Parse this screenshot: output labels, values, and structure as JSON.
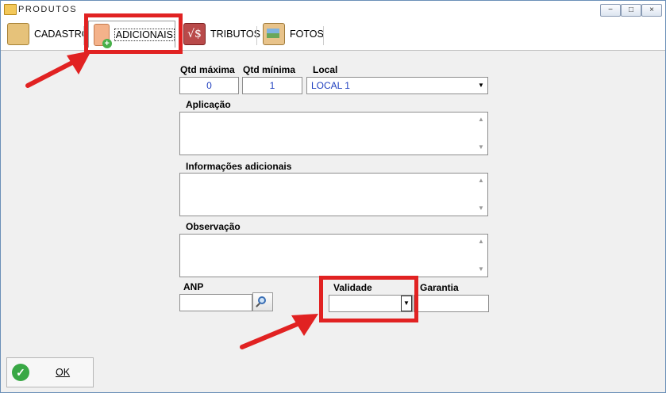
{
  "window": {
    "title": "PRODUTOS",
    "controls": {
      "minimize": "−",
      "maximize": "□",
      "close": "×"
    }
  },
  "tabs": [
    {
      "label": "CADASTRO",
      "icon": "box-barcode-icon"
    },
    {
      "label": "ADICIONAIS",
      "icon": "box-add-icon",
      "active": true
    },
    {
      "label": "TRIBUTOS",
      "icon": "tax-icon",
      "glyph": "√$"
    },
    {
      "label": "FOTOS",
      "icon": "photo-icon"
    }
  ],
  "form": {
    "qtd_maxima": {
      "label": "Qtd máxima",
      "value": "0"
    },
    "qtd_minima": {
      "label": "Qtd mínima",
      "value": "1"
    },
    "local": {
      "label": "Local",
      "value": "LOCAL 1"
    },
    "aplicacao": {
      "label": "Aplicação",
      "value": ""
    },
    "info_adicionais": {
      "label": "Informações adicionais",
      "value": ""
    },
    "observacao": {
      "label": "Observação",
      "value": ""
    },
    "anp": {
      "label": "ANP",
      "value": ""
    },
    "validade": {
      "label": "Validade",
      "value": ""
    },
    "garantia": {
      "label": "Garantia",
      "value": ""
    }
  },
  "footer": {
    "ok_label": "OK"
  },
  "glyphs": {
    "down": "▼",
    "up": "▲",
    "check": "✓"
  },
  "colors": {
    "highlight": "#e12222",
    "value_text": "#1f3fbf",
    "ok_green": "#39a845"
  }
}
